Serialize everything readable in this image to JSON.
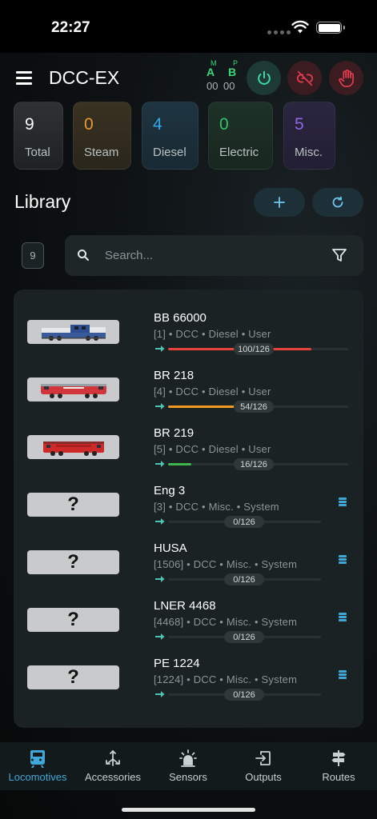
{
  "status_bar": {
    "time": "22:27"
  },
  "header": {
    "title": "DCC-EX",
    "track_a": {
      "mode": "M",
      "letter": "A",
      "value": "00"
    },
    "track_b": {
      "mode": "P",
      "letter": "B",
      "value": "00"
    },
    "colors": {
      "power": "#3fd6a0",
      "link": "#e23a4f",
      "stop": "#e23a4f"
    }
  },
  "stats": [
    {
      "count": "9",
      "label": "Total"
    },
    {
      "count": "0",
      "label": "Steam"
    },
    {
      "count": "4",
      "label": "Diesel"
    },
    {
      "count": "0",
      "label": "Electric"
    },
    {
      "count": "5",
      "label": "Misc."
    }
  ],
  "library": {
    "title": "Library",
    "count": "9"
  },
  "search": {
    "placeholder": "Search...",
    "value": ""
  },
  "locos": [
    {
      "name": "BB 66000",
      "meta": "[1] • DCC • Diesel • User",
      "speed_label": "100/126",
      "speed": 100,
      "max": 126,
      "color": "#e8423c",
      "image": "blue-white-diesel",
      "system": false
    },
    {
      "name": "BR 218",
      "meta": "[4] • DCC • Diesel • User",
      "speed_label": "54/126",
      "speed": 54,
      "max": 126,
      "color": "#f09a22",
      "image": "red-diesel",
      "system": false
    },
    {
      "name": "BR 219",
      "meta": "[5] • DCC • Diesel • User",
      "speed_label": "16/126",
      "speed": 16,
      "max": 126,
      "color": "#3fb54d",
      "image": "red-diesel-2",
      "system": false
    },
    {
      "name": "Eng 3",
      "meta": "[3] • DCC • Misc. • System",
      "speed_label": "0/126",
      "speed": 0,
      "max": 126,
      "color": "#3fb54d",
      "image": "unknown",
      "unknown_glyph": "?",
      "system": true
    },
    {
      "name": "HUSA",
      "meta": "[1506] • DCC • Misc. • System",
      "speed_label": "0/126",
      "speed": 0,
      "max": 126,
      "color": "#3fb54d",
      "image": "unknown",
      "unknown_glyph": "?",
      "system": true
    },
    {
      "name": "LNER 4468",
      "meta": "[4468] • DCC • Misc. • System",
      "speed_label": "0/126",
      "speed": 0,
      "max": 126,
      "color": "#3fb54d",
      "image": "unknown",
      "unknown_glyph": "?",
      "system": true
    },
    {
      "name": "PE 1224",
      "meta": "[1224] • DCC • Misc. • System",
      "speed_label": "0/126",
      "speed": 0,
      "max": 126,
      "color": "#3fb54d",
      "image": "unknown",
      "unknown_glyph": "?",
      "system": true
    }
  ],
  "nav": [
    {
      "label": "Locomotives",
      "icon": "train-icon",
      "active": true
    },
    {
      "label": "Accessories",
      "icon": "accessories-icon",
      "active": false
    },
    {
      "label": "Sensors",
      "icon": "sensor-icon",
      "active": false
    },
    {
      "label": "Outputs",
      "icon": "output-icon",
      "active": false
    },
    {
      "label": "Routes",
      "icon": "signpost-icon",
      "active": false
    }
  ],
  "accent_color": "#3fa8d8"
}
